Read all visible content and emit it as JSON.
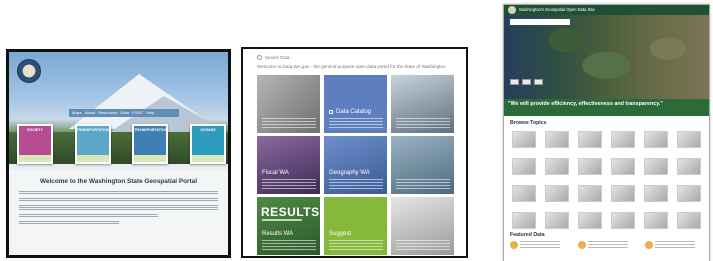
{
  "geoportal": {
    "nav": [
      "Maps",
      "About",
      "Resources",
      "Data",
      "FGDC",
      "Help"
    ],
    "cards": [
      {
        "title": "SOCIETY",
        "foot": "",
        "color": "#b64d93"
      },
      {
        "title": "TRANSPORTATION",
        "foot": "",
        "color": "#5aa7c8"
      },
      {
        "title": "TRANSPORTATION",
        "foot": "",
        "color": "#3f7fb4"
      },
      {
        "title": "OCEANS",
        "foot": "",
        "color": "#2c9bbd"
      }
    ],
    "welcome": "Welcome to the Washington State Geospatial Portal"
  },
  "datawa": {
    "search_label": "Search Data",
    "intro": "Welcome to Data.WA.gov - the general purpose open data portal for the State of Washington",
    "tiles": [
      {
        "label": "Data Catalog",
        "color": "#5d7fbf"
      },
      {
        "label": "",
        "color": "#8a9aa8"
      },
      {
        "label": "",
        "color": "#7a5b8c"
      },
      {
        "label": "Fiscal WA",
        "color": "#5e3f7c"
      },
      {
        "label": "Geography WA",
        "color": "#4a6fa8"
      },
      {
        "label": "",
        "color": "#6f8fa3"
      },
      {
        "label": "Results WA",
        "color": "#3c6d3a"
      },
      {
        "label": "Suggest",
        "color": "#86b83c"
      },
      {
        "label": "",
        "color": "#b9b9b9"
      }
    ],
    "results_logo": "RESULTS"
  },
  "opendata": {
    "title": "Washington's Geospatial Open Data Site",
    "map_search_placeholder": "",
    "quote": "\"We will provide efficiency, effectiveness and transparency.\"",
    "browse_title": "Browse Topics",
    "topics": [
      "",
      "",
      "",
      "",
      "",
      "",
      "",
      "",
      "",
      "",
      "",
      "",
      "",
      "",
      "",
      "",
      "",
      "",
      "",
      "",
      "",
      "",
      "",
      ""
    ],
    "featured_title": "Featured Data"
  }
}
